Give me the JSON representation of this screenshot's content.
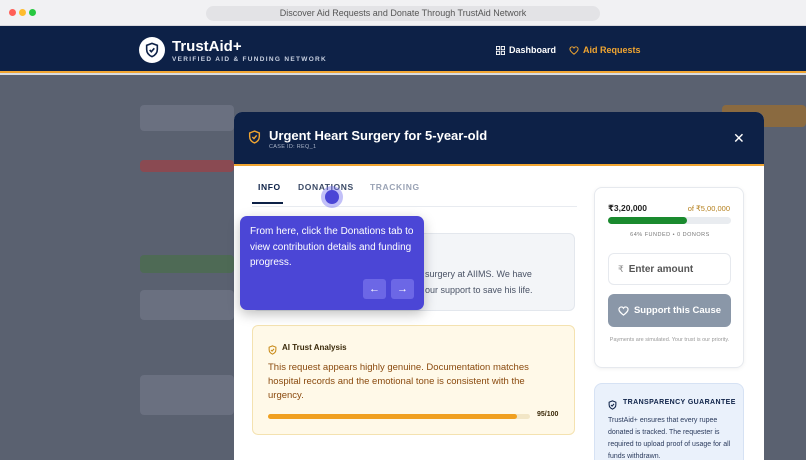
{
  "browser": {
    "url_title": "Discover Aid Requests and Donate Through TrustAid Network"
  },
  "header": {
    "brand": "TrustAid+",
    "tagline": "VERIFIED AID & FUNDING NETWORK",
    "nav": [
      {
        "label": "Dashboard",
        "icon": "grid-icon"
      },
      {
        "label": "Aid Requests",
        "icon": "heart-icon",
        "active": true
      }
    ]
  },
  "modal": {
    "title": "Urgent Heart Surgery for 5-year-old",
    "case_id": "CASE ID: REQ_1",
    "tabs": [
      "INFO",
      "DONATIONS",
      "TRACKING"
    ],
    "active_tab": "INFO",
    "description_visible": "surgery at AIIMS. We have our support to save his life.",
    "description_line1": "surgery at AIIMS. We have",
    "description_line2": "our support to save his life.",
    "trust": {
      "title": "AI Trust Analysis",
      "text": "This request appears highly genuine. Documentation matches hospital records and the emotional tone is consistent with the urgency.",
      "score": 95,
      "score_label": "95/100"
    },
    "funding": {
      "raised": "₹3,20,000",
      "goal": "of ₹5,00,000",
      "progress": 0.64,
      "stats": "64% FUNDED • 0 DONORS",
      "currency_symbol": "₹",
      "amount_placeholder": "Enter amount",
      "support_label": "Support this Cause",
      "note": "Payments are simulated. Your trust is our priority."
    },
    "guarantee": {
      "title": "TRANSPARENCY GUARANTEE",
      "text": "TrustAid+ ensures that every rupee donated is tracked. The requester is required to upload proof of usage for all funds withdrawn."
    }
  },
  "tooltip": {
    "text": "From here, click the Donations tab to view contribution details and funding progress.",
    "prev": "←",
    "next": "→"
  },
  "colors": {
    "navy": "#0d2147",
    "accent": "#f0a531",
    "tour": "#4b46d6",
    "success": "#1a8a2e"
  }
}
